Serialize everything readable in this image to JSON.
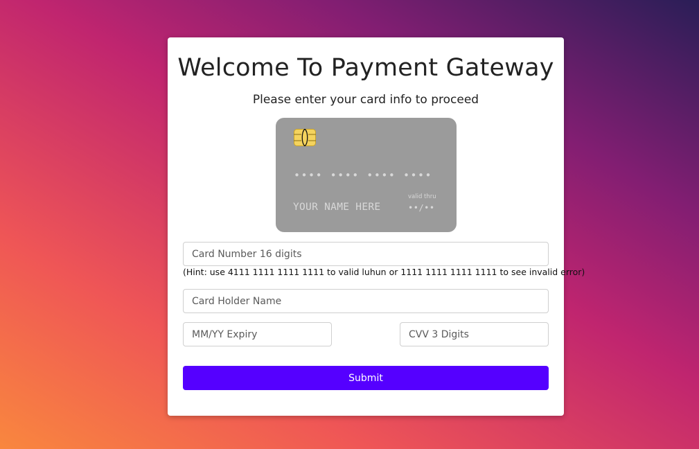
{
  "page": {
    "title": "Welcome To Payment Gateway",
    "subtitle": "Please enter your card info to proceed"
  },
  "card_preview": {
    "number": "•••• •••• •••• ••••",
    "name": "YOUR NAME HERE",
    "valid_thru_label": "valid thru",
    "expiry": "••/••",
    "background": "#9b9b9b",
    "chip_color": "#f4d35e"
  },
  "form": {
    "card_number": {
      "value": "",
      "placeholder": "Card Number 16 digits"
    },
    "hint": "(Hint: use 4111 1111 1111 1111 to valid luhun or 1111 1111 1111 1111 to see invalid error)",
    "card_holder": {
      "value": "",
      "placeholder": "Card Holder Name"
    },
    "expiry": {
      "value": "",
      "placeholder": "MM/YY Expiry"
    },
    "cvv": {
      "value": "",
      "placeholder": "CVV 3 Digits"
    },
    "submit_label": "Submit"
  },
  "colors": {
    "accent": "#5500ff",
    "panel": "#ffffff"
  }
}
